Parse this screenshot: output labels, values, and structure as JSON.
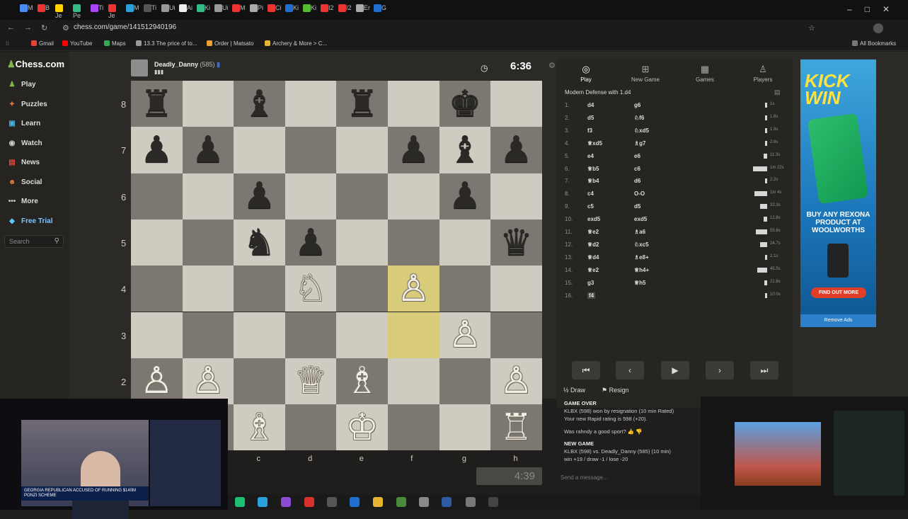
{
  "browser": {
    "url": "chess.com/game/141512940196",
    "bookmarks": [
      "Gmail",
      "YouTube",
      "Maps",
      "13.3 The price of to...",
      "Order | Matsato",
      "Archery & More > C...",
      "All Bookmarks"
    ],
    "tab_labels": [
      "M",
      "B",
      "Je",
      "Pe",
      "Ti",
      "Je",
      "M",
      "Ti",
      "Ui",
      "Ai",
      "Ki",
      "Ui",
      "M",
      "Pi",
      "Ci",
      "Ki",
      "Ki",
      "I2",
      "I2",
      "Er",
      "G"
    ]
  },
  "sidebar": {
    "logo": "Chess.com",
    "items": [
      {
        "label": "Play",
        "icon": "pawn-icon"
      },
      {
        "label": "Puzzles",
        "icon": "puzzle-icon"
      },
      {
        "label": "Learn",
        "icon": "book-icon"
      },
      {
        "label": "Watch",
        "icon": "binoculars-icon"
      },
      {
        "label": "News",
        "icon": "news-icon"
      },
      {
        "label": "Social",
        "icon": "social-icon"
      },
      {
        "label": "More",
        "icon": "more-icon"
      },
      {
        "label": "Free Trial",
        "icon": "diamond-icon"
      }
    ],
    "search_placeholder": "Search"
  },
  "opponent": {
    "name": "Deadly_Danny",
    "rating": "(585)",
    "clock": "6:36"
  },
  "player": {
    "clock": "4:39"
  },
  "board": {
    "ranks": [
      "8",
      "7",
      "6",
      "5",
      "4",
      "3",
      "2"
    ],
    "files": [
      "c",
      "d",
      "e",
      "f",
      "g",
      "h"
    ],
    "highlight_squares": [
      "f3",
      "f4"
    ],
    "pieces": [
      {
        "sq": "a8",
        "glyph": "♜",
        "side": "black"
      },
      {
        "sq": "c8",
        "glyph": "♝",
        "side": "black"
      },
      {
        "sq": "e8",
        "glyph": "♜",
        "side": "black"
      },
      {
        "sq": "g8",
        "glyph": "♚",
        "side": "black"
      },
      {
        "sq": "a7",
        "glyph": "♟",
        "side": "black"
      },
      {
        "sq": "b7",
        "glyph": "♟",
        "side": "black"
      },
      {
        "sq": "f7",
        "glyph": "♟",
        "side": "black"
      },
      {
        "sq": "g7",
        "glyph": "♝",
        "side": "black"
      },
      {
        "sq": "h7",
        "glyph": "♟",
        "side": "black"
      },
      {
        "sq": "c6",
        "glyph": "♟",
        "side": "black"
      },
      {
        "sq": "g6",
        "glyph": "♟",
        "side": "black"
      },
      {
        "sq": "c5",
        "glyph": "♞",
        "side": "black"
      },
      {
        "sq": "d5",
        "glyph": "♟",
        "side": "black"
      },
      {
        "sq": "h5",
        "glyph": "♛",
        "side": "black"
      },
      {
        "sq": "d4",
        "glyph": "♘",
        "side": "white"
      },
      {
        "sq": "f4",
        "glyph": "♙",
        "side": "white"
      },
      {
        "sq": "g3",
        "glyph": "♙",
        "side": "white"
      },
      {
        "sq": "a2",
        "glyph": "♙",
        "side": "white"
      },
      {
        "sq": "b2",
        "glyph": "♙",
        "side": "white"
      },
      {
        "sq": "d2",
        "glyph": "♕",
        "side": "white"
      },
      {
        "sq": "e2",
        "glyph": "♗",
        "side": "white"
      },
      {
        "sq": "h2",
        "glyph": "♙",
        "side": "white"
      },
      {
        "sq": "c1",
        "glyph": "♗",
        "side": "white"
      },
      {
        "sq": "e1",
        "glyph": "♔",
        "side": "white"
      },
      {
        "sq": "h1",
        "glyph": "♖",
        "side": "white"
      }
    ]
  },
  "panel": {
    "tabs": [
      {
        "label": "Play",
        "icon": "play-icon"
      },
      {
        "label": "New Game",
        "icon": "plus-icon"
      },
      {
        "label": "Games",
        "icon": "games-icon"
      },
      {
        "label": "Players",
        "icon": "players-icon"
      }
    ],
    "opening": "Modern Defense with 1.d4",
    "moves": [
      {
        "n": "1.",
        "w": "d4",
        "b": "g6",
        "bar": 3,
        "t": "1s"
      },
      {
        "n": "2.",
        "w": "d5",
        "b": "♘f6",
        "bar": 3,
        "t": "1.8s"
      },
      {
        "n": "3.",
        "w": "f3",
        "b": "♘xd5",
        "bar": 3,
        "t": "1.9s"
      },
      {
        "n": "4.",
        "w": "♕xd5",
        "b": "♗g7",
        "bar": 3,
        "t": "2.6s"
      },
      {
        "n": "5.",
        "w": "e4",
        "b": "e6",
        "bar": 5,
        "t": "11.3s"
      },
      {
        "n": "6.",
        "w": "♕b5",
        "b": "c6",
        "bar": 20,
        "t": "1m 22s"
      },
      {
        "n": "7.",
        "w": "♕b4",
        "b": "d6",
        "bar": 3,
        "t": "2.2s"
      },
      {
        "n": "8.",
        "w": "c4",
        "b": "O-O",
        "bar": 18,
        "t": "1m 4s"
      },
      {
        "n": "9.",
        "w": "c5",
        "b": "d5",
        "bar": 10,
        "t": "32.3s"
      },
      {
        "n": "10.",
        "w": "exd5",
        "b": "exd5",
        "bar": 5,
        "t": "12.8s"
      },
      {
        "n": "11.",
        "w": "♕e2",
        "b": "♗a6",
        "bar": 16,
        "t": "55.8s"
      },
      {
        "n": "12.",
        "w": "♕d2",
        "b": "♘xc5",
        "bar": 10,
        "t": "24.7s"
      },
      {
        "n": "13.",
        "w": "♕d4",
        "b": "♗e8+",
        "bar": 3,
        "t": "2.1s"
      },
      {
        "n": "14.",
        "w": "♕e2",
        "b": "♕h4+",
        "bar": 14,
        "t": "45.5s"
      },
      {
        "n": "15.",
        "w": "g3",
        "b": "♕h5",
        "bar": 4,
        "t": "21.8s"
      },
      {
        "n": "16.",
        "w": "f4",
        "b": "",
        "bar": 3,
        "t": "10.0s"
      }
    ],
    "draw": "Draw",
    "resign": "Resign"
  },
  "chat": {
    "game_over": "GAME OVER",
    "result": "KLBX (598) won by resignation (10 min Rated)",
    "rating": "Your new Rapid rating is 598 (+20).",
    "sport": "Was rahndy a good sport?",
    "new_game": "NEW GAME",
    "matchup": "KLBX (598) vs. Deadly_Danny (585) (10 min)",
    "odds": "win +19 / draw -1 / lose -20",
    "placeholder": "Send a message..."
  },
  "ad": {
    "headline": "KICK WIN",
    "offer": "BUY ANY REXONA PRODUCT AT WOOLWORTHS",
    "cta": "FIND OUT MORE",
    "remove": "Remove Ads"
  },
  "overlay": {
    "ticker": "GEORGIA REPUBLICAN ACCUSED OF RUNNING $140M PONZI SCHEME"
  }
}
